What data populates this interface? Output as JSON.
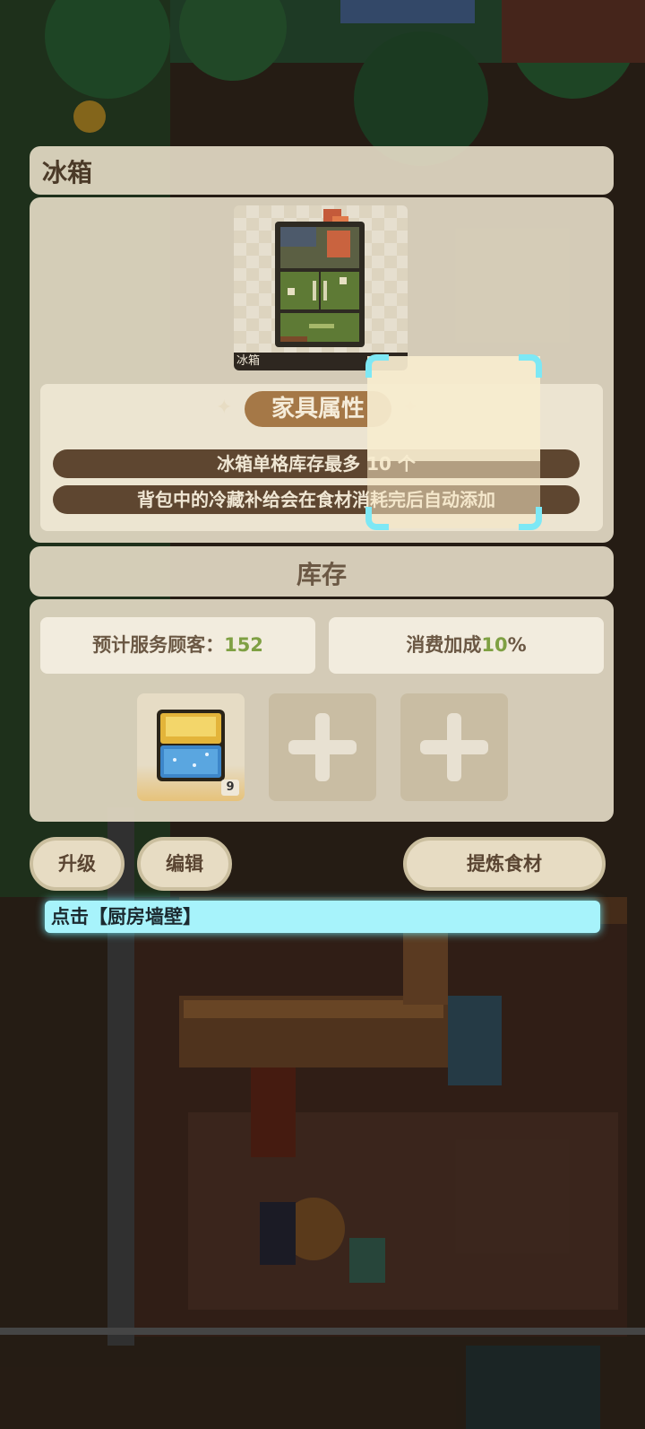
{
  "dialog": {
    "title": "冰箱",
    "furniture_name": "冰箱",
    "attributes_header": "家具属性",
    "attributes": [
      "冰箱单格库存最多 10 个",
      "背包中的冷藏补给会在食材消耗完后自动添加"
    ]
  },
  "stock": {
    "title": "库存",
    "customers_label": "预计服务顾客：",
    "customers_value": "152",
    "bonus_label": "消费加成",
    "bonus_value": "10",
    "bonus_unit": "%",
    "slots": [
      {
        "item_icon": "cold-storage-crate-icon",
        "count": "9"
      },
      {
        "item_icon": "add-icon"
      },
      {
        "item_icon": "add-icon"
      }
    ]
  },
  "actions": {
    "upgrade": "升级",
    "edit": "编辑",
    "refine": "提炼食材"
  },
  "tutorial": {
    "hint": "点击【厨房墙壁】"
  },
  "colors": {
    "accent_cyan": "#7de8f5",
    "value_green": "#7fa043",
    "header_brown": "#a57847"
  }
}
